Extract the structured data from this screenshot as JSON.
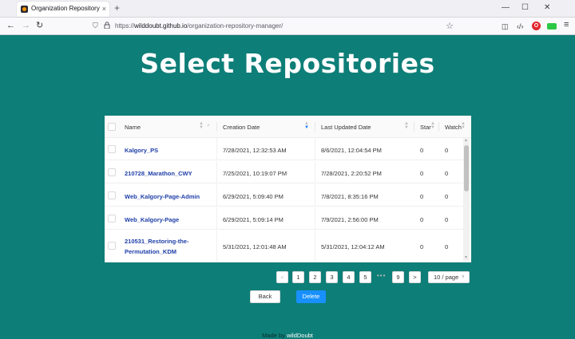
{
  "browser": {
    "tab_title": "Organization Repository Mana",
    "tab_close": "×",
    "new_tab": "+",
    "window_controls": [
      "—",
      "☐",
      "✕"
    ],
    "nav": {
      "back": "←",
      "forward": "→",
      "reload": "↻"
    },
    "url_prefix": "https://",
    "url_host": "wilddoubt.github.io",
    "url_path": "/organization-repository-manager/",
    "icons": {
      "shield": "shield-icon",
      "lock": "lock-icon",
      "star": "bookmark-star-icon"
    },
    "toolbar_glyphs": {
      "pocket": "◫",
      "devtools": "‹/›",
      "opera": "O",
      "menu": "≡",
      "star": "☆",
      "shield": "⛉",
      "lock": "🔒"
    }
  },
  "page": {
    "title": "Select Repositories"
  },
  "table": {
    "columns": {
      "name": "Name",
      "created": "Creation Date",
      "updated": "Last Updated Date",
      "star": "Star",
      "watch": "Watch"
    },
    "sort_active_column": "Creation Date",
    "rows": [
      {
        "name": "Kalgory_PS",
        "created": "7/28/2021, 12:32:53 AM",
        "updated": "8/6/2021, 12:04:54 PM",
        "star": "0",
        "watch": "0"
      },
      {
        "name": "210728_Marathon_CWY",
        "created": "7/25/2021, 10:19:07 PM",
        "updated": "7/28/2021, 2:20:52 PM",
        "star": "0",
        "watch": "0"
      },
      {
        "name": "Web_Kalgory-Page-Admin",
        "created": "6/29/2021, 5:09:40 PM",
        "updated": "7/8/2021, 8:35:16 PM",
        "star": "0",
        "watch": "0"
      },
      {
        "name": "Web_Kalgory-Page",
        "created": "6/29/2021, 5:09:14 PM",
        "updated": "7/9/2021, 2:56:00 PM",
        "star": "0",
        "watch": "0"
      },
      {
        "name": "210531_Restoring-the-Permutation_KDM",
        "created": "5/31/2021, 12:01:48 AM",
        "updated": "5/31/2021, 12:04:12 AM",
        "star": "0",
        "watch": "0"
      }
    ]
  },
  "pagination": {
    "prev": "<",
    "pages": [
      "1",
      "2",
      "3",
      "4",
      "5"
    ],
    "ellipsis": "•••",
    "last_page": "9",
    "next": ">",
    "page_size": "10 / page",
    "page_size_chevron": "∨"
  },
  "actions": {
    "back_label": "Back",
    "delete_label": "Delete"
  },
  "footer": {
    "prefix": "Made by ",
    "author": "wildDoubt"
  },
  "colors": {
    "background": "#0e7e78",
    "link": "#1f3fa8",
    "primary": "#1890ff"
  }
}
